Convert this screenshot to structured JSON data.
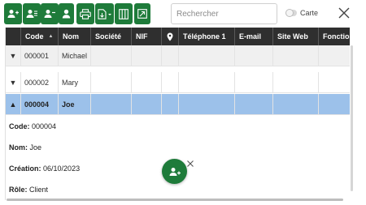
{
  "toolbar": {
    "buttons": [
      {
        "name": "add-user-icon"
      },
      {
        "name": "user-list-icon"
      },
      {
        "name": "remove-user-icon"
      },
      {
        "name": "user-icon"
      },
      {
        "name": "print-icon"
      },
      {
        "name": "export-dropdown-icon"
      },
      {
        "name": "columns-icon"
      },
      {
        "name": "open-external-icon"
      }
    ],
    "accent": "#1e7b3a"
  },
  "search": {
    "placeholder": "Rechercher",
    "value": ""
  },
  "map_toggle": {
    "label": "Carte",
    "checked": false
  },
  "grid": {
    "columns": [
      "",
      "Code",
      "Nom",
      "Société",
      "NIF",
      "",
      "Téléphone 1",
      "E-mail",
      "Site Web",
      "Fonction"
    ],
    "sort_column": "Code",
    "rows": [
      {
        "code": "000001",
        "nom": "Michael",
        "expanded": false
      },
      {
        "code": "000002",
        "nom": "Mary",
        "expanded": false
      },
      {
        "code": "000004",
        "nom": "Joe",
        "expanded": true
      }
    ],
    "header_bg": "#2f2f2f",
    "selected_bg": "#9cc1ea"
  },
  "detail": {
    "code_label": "Code:",
    "code_value": "000004",
    "nom_label": "Nom:",
    "nom_value": "Joe",
    "creation_label": "Création:",
    "creation_value": "06/10/2023",
    "role_label": "Rôle:",
    "role_value": "Client"
  },
  "fab": {
    "icon": "add-user-icon"
  }
}
